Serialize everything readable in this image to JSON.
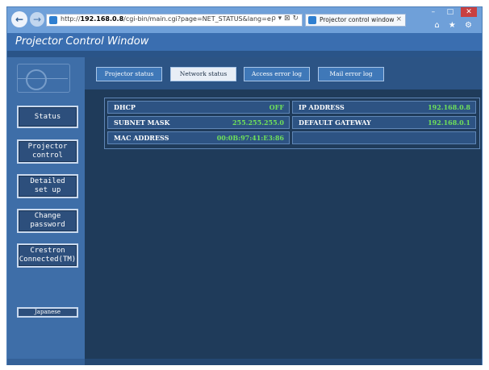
{
  "browser": {
    "address_prefix": "http://",
    "address_host": "192.168.0.8",
    "address_path": "/cgi-bin/main.cgi?page=NET_STATUS&lang=e",
    "address_controls": "ρ ▾ ⊠ ↻",
    "tab_title": "Projector control window",
    "tab_close": "×",
    "min": "–",
    "max": "□",
    "close": "✕",
    "toolbar_icons": "⌂ ★ ⚙",
    "back": "←",
    "forward": "→"
  },
  "page": {
    "title": "Projector Control Window"
  },
  "sidebar": {
    "buttons": [
      {
        "label": "Status"
      },
      {
        "label": "Projector\ncontrol"
      },
      {
        "label": "Detailed\nset up"
      },
      {
        "label": "Change\npassword"
      },
      {
        "label": "Crestron\nConnected(TM)"
      }
    ],
    "language": "Japanese"
  },
  "tabs": [
    {
      "label": "Projector status"
    },
    {
      "label": "Network status"
    },
    {
      "label": "Access error log"
    },
    {
      "label": "Mail error log"
    }
  ],
  "network": {
    "dhcp_label": "DHCP",
    "dhcp_value": "OFF",
    "ip_label": "IP ADDRESS",
    "ip_value": "192.168.0.8",
    "subnet_label": "SUBNET MASK",
    "subnet_value": "255.255.255.0",
    "gateway_label": "DEFAULT GATEWAY",
    "gateway_value": "192.168.0.1",
    "mac_label": "MAC ADDRESS",
    "mac_value": "00:0B:97:41:E3:86"
  },
  "colors": {
    "value_green": "#6fe05a",
    "frame_blue": "#6f9fd8",
    "content_dark": "#1f3b5a"
  }
}
